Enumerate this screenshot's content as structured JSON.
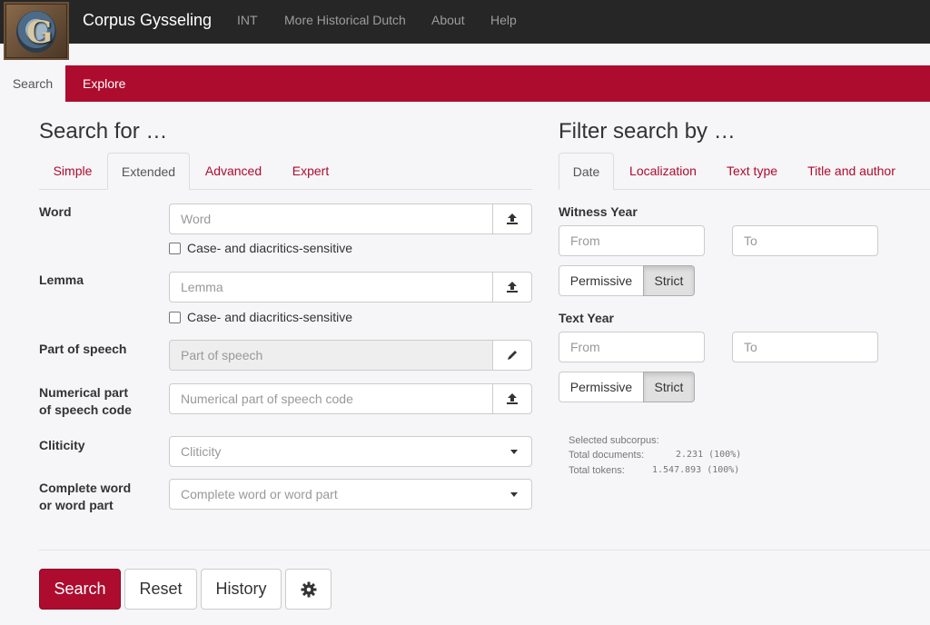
{
  "navbar": {
    "brand": "Corpus Gysseling",
    "links": [
      "INT",
      "More Historical Dutch",
      "About",
      "Help"
    ],
    "logo_letter": "G"
  },
  "main_tabs": {
    "search": "Search",
    "explore": "Explore"
  },
  "search_panel": {
    "heading": "Search for …",
    "tabs": [
      "Simple",
      "Extended",
      "Advanced",
      "Expert"
    ],
    "active_tab": "Extended",
    "fields": {
      "word": {
        "label": "Word",
        "placeholder": "Word",
        "checkbox": "Case- and diacritics-sensitive",
        "button_icon": "upload-icon"
      },
      "lemma": {
        "label": "Lemma",
        "placeholder": "Lemma",
        "checkbox": "Case- and diacritics-sensitive",
        "button_icon": "upload-icon"
      },
      "pos": {
        "label": "Part of speech",
        "placeholder": "Part of speech",
        "button_icon": "pencil-icon"
      },
      "numpos": {
        "label_line1": "Numerical part",
        "label_line2": "of speech code",
        "placeholder": "Numerical part of speech code",
        "button_icon": "upload-icon"
      },
      "cliticity": {
        "label": "Cliticity",
        "value": "Cliticity"
      },
      "complete": {
        "label_line1": "Complete word",
        "label_line2": "or word part",
        "value": "Complete word or word part"
      }
    }
  },
  "filter_panel": {
    "heading": "Filter search by …",
    "tabs": [
      "Date",
      "Localization",
      "Text type",
      "Title and author"
    ],
    "active_tab": "Date",
    "witness_year": {
      "label": "Witness Year",
      "from": "From",
      "to": "To",
      "permissive": "Permissive",
      "strict": "Strict"
    },
    "text_year": {
      "label": "Text Year",
      "from": "From",
      "to": "To",
      "permissive": "Permissive",
      "strict": "Strict"
    },
    "summary": {
      "title": "Selected subcorpus:",
      "docs_label": "Total documents:",
      "docs_value": "2.231 (100%)",
      "tokens_label": "Total tokens:",
      "tokens_value": "1.547.893 (100%)"
    }
  },
  "actions": {
    "search": "Search",
    "reset": "Reset",
    "history": "History",
    "settings_icon": "gear-icon"
  },
  "colors": {
    "accent": "#ad0c2e",
    "navbar": "#262626",
    "background": "#f6f5f7"
  }
}
